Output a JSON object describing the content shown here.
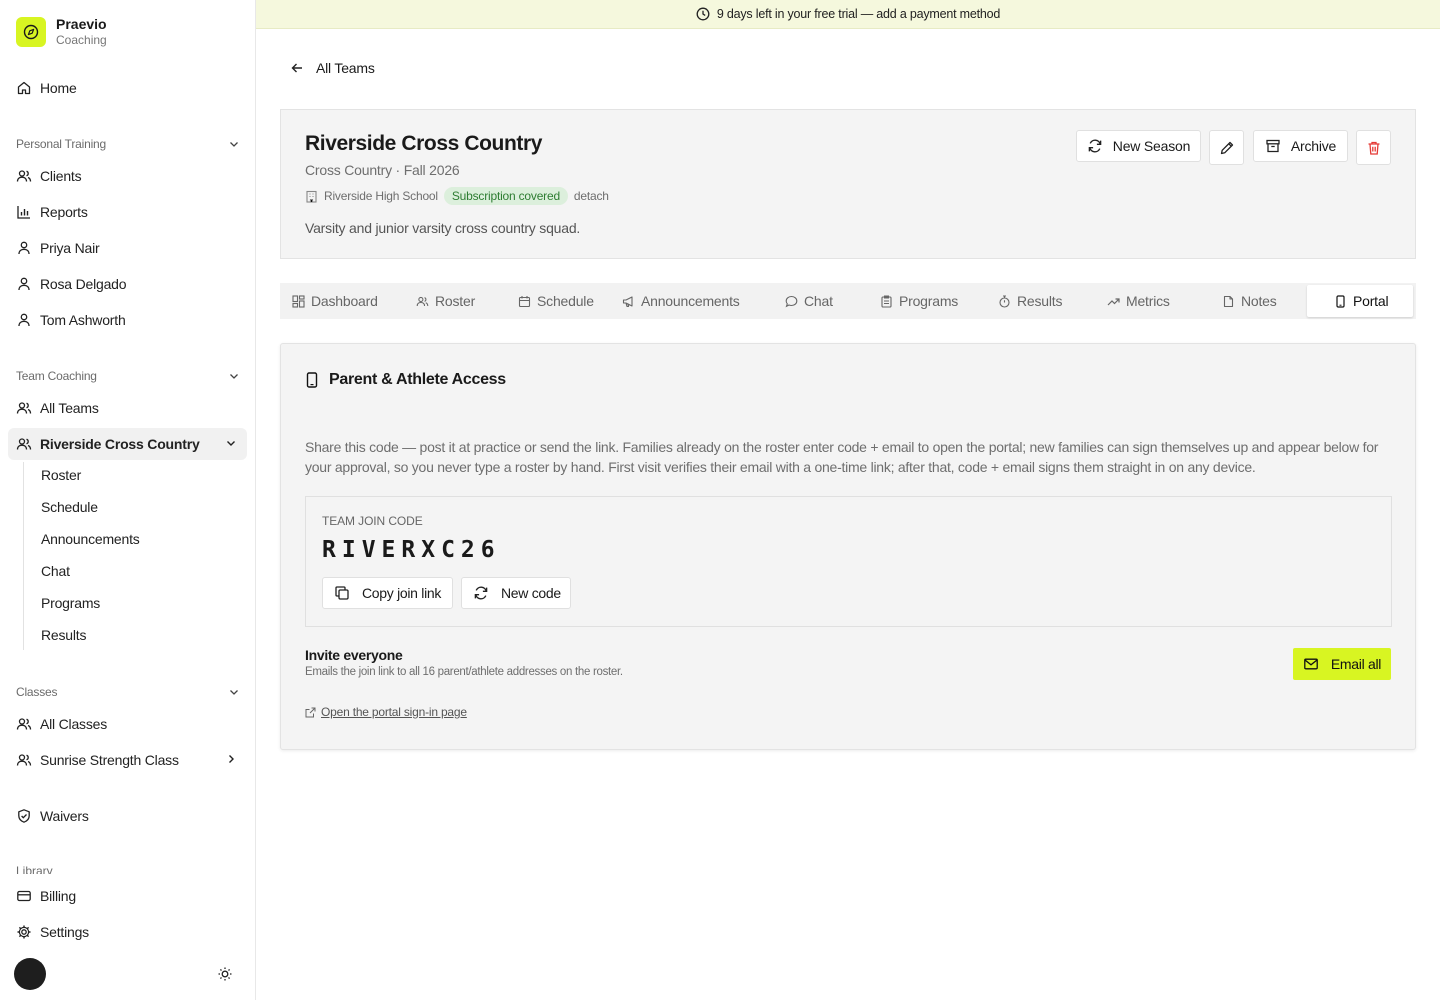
{
  "brand": {
    "name": "Praevio",
    "subtitle": "Coaching"
  },
  "banner": {
    "text": "9 days left in your free trial — add a payment method"
  },
  "sidebar": {
    "home": "Home",
    "personal_training": {
      "label": "Personal Training",
      "items": [
        "Clients",
        "Reports",
        "Priya Nair",
        "Rosa Delgado",
        "Tom Ashworth"
      ]
    },
    "team_coaching": {
      "label": "Team Coaching",
      "all_teams": "All Teams",
      "active_team": "Riverside Cross Country",
      "sub_items": [
        "Roster",
        "Schedule",
        "Announcements",
        "Chat",
        "Programs",
        "Results"
      ]
    },
    "classes": {
      "label": "Classes",
      "items": [
        "All Classes",
        "Sunrise Strength Class"
      ]
    },
    "waivers": "Waivers",
    "library_label": "Library",
    "billing": "Billing",
    "settings": "Settings"
  },
  "back": {
    "label": "All Teams"
  },
  "team": {
    "title": "Riverside Cross Country",
    "meta": "Cross Country · Fall 2026",
    "school": "Riverside High School",
    "badge": "Subscription covered",
    "detach": "detach",
    "description": "Varsity and junior varsity cross country squad.",
    "actions": {
      "new_season": "New Season",
      "archive": "Archive"
    }
  },
  "tabs": [
    "Dashboard",
    "Roster",
    "Schedule",
    "Announcements",
    "Chat",
    "Programs",
    "Results",
    "Metrics",
    "Notes",
    "Portal"
  ],
  "active_tab": "Portal",
  "portal": {
    "title": "Parent & Athlete Access",
    "description": "Share this code — post it at practice or send the link. Families already on the roster enter code + email to open the portal; new families can sign themselves up and appear below for your approval, so you never type a roster by hand. First visit verifies their email with a one-time link; after that, code + email signs them straight in on any device.",
    "join_label": "TEAM JOIN CODE",
    "join_code": "RIVERXC26",
    "copy_link": "Copy join link",
    "new_code": "New code",
    "invite_title": "Invite everyone",
    "invite_sub": "Emails the join link to all 16 parent/athlete addresses on the roster.",
    "email_all": "Email all",
    "open_portal": "Open the portal sign-in page"
  },
  "colors": {
    "accent": "#d8f522",
    "badge_bg": "#dcefdc",
    "badge_text": "#2e7d32",
    "danger": "#e53935"
  }
}
